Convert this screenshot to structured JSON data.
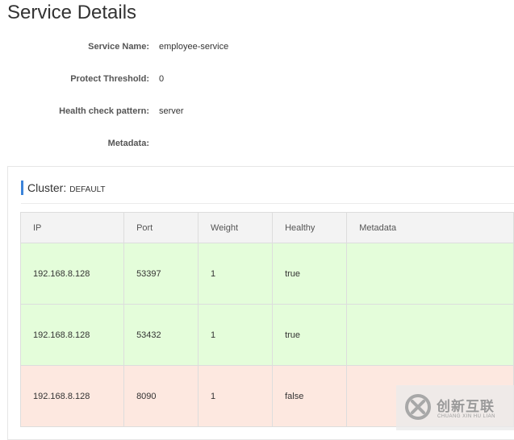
{
  "page": {
    "title": "Service Details"
  },
  "details": [
    {
      "label": "Service Name:",
      "value": "employee-service"
    },
    {
      "label": "Protect Threshold:",
      "value": "0"
    },
    {
      "label": "Health check pattern:",
      "value": "server"
    },
    {
      "label": "Metadata:",
      "value": ""
    }
  ],
  "cluster": {
    "title": "Cluster:",
    "name": "DEFAULT",
    "accent_color": "#3c84d9",
    "columns": [
      "IP",
      "Port",
      "Weight",
      "Healthy",
      "Metadata"
    ],
    "instances": [
      {
        "ip": "192.168.8.128",
        "port": "53397",
        "weight": "1",
        "healthy": "true",
        "metadata": ""
      },
      {
        "ip": "192.168.8.128",
        "port": "53432",
        "weight": "1",
        "healthy": "true",
        "metadata": ""
      },
      {
        "ip": "192.168.8.128",
        "port": "8090",
        "weight": "1",
        "healthy": "false",
        "metadata": ""
      }
    ],
    "row_colors": {
      "healthy": "#e4fdda",
      "unhealthy": "#fde8e0"
    }
  },
  "watermark": {
    "text": "创新互联",
    "subtext": "CHUANG XIN HU LIAN",
    "logo_icon": "watermark-logo-icon"
  }
}
